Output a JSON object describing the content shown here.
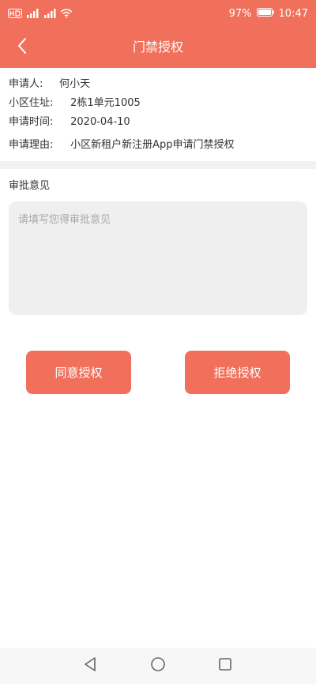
{
  "status_bar": {
    "battery_percent": "97%",
    "time": "10:47",
    "left_indicators": [
      "hd-icon",
      "signal-icon",
      "signal-icon",
      "wifi-icon"
    ]
  },
  "header": {
    "title": "门禁授权",
    "back_icon": "chevron-left-icon"
  },
  "application": {
    "applicant_label": "申请人:",
    "applicant_value": "何小天",
    "address_label": "小区住址:",
    "address_value": "2栋1单元1005",
    "time_label": "申请时间:",
    "time_value": "2020-04-10",
    "reason_label": "申请理由:",
    "reason_value": "小区新租户新注册App申请门禁授权"
  },
  "review": {
    "section_label": "审批意见",
    "opinion_placeholder": "请填写您得审批意见",
    "opinion_value": ""
  },
  "actions": {
    "approve_label": "同意授权",
    "reject_label": "拒绝授权"
  },
  "colors": {
    "accent": "#f0705c",
    "divider": "#f2f2f2",
    "input_bg": "#efefef",
    "text": "#333333",
    "placeholder": "#a8a8a8"
  },
  "navigation_bar": {
    "buttons": [
      "back-triangle-icon",
      "home-circle-icon",
      "recents-square-icon"
    ]
  }
}
